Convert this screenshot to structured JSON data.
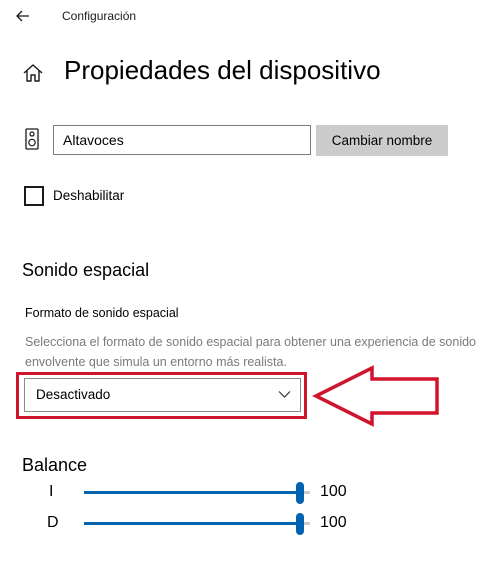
{
  "window": {
    "app_title": "Configuración"
  },
  "header": {
    "page_title": "Propiedades del dispositivo"
  },
  "device": {
    "name_value": "Altavoces",
    "rename_button_label": "Cambiar nombre"
  },
  "disable": {
    "label": "Deshabilitar",
    "checked": false
  },
  "spatial_sound": {
    "section_title": "Sonido espacial",
    "format_label": "Formato de sonido espacial",
    "format_description": "Selecciona el formato de sonido espacial para obtener una experiencia de sonido envolvente que simula un entorno más realista.",
    "selected_format": "Desactivado"
  },
  "balance": {
    "section_title": "Balance",
    "channels": [
      {
        "label": "I",
        "value": "100",
        "level": 1.0
      },
      {
        "label": "D",
        "value": "100",
        "level": 1.0
      }
    ]
  },
  "icons": {
    "back": "back-arrow-icon",
    "home": "home-icon",
    "speaker": "speaker-icon",
    "chevron": "chevron-down-icon"
  },
  "colors": {
    "accent": "#0063b1",
    "annotation_red": "#d0142c",
    "button_gray": "#cccccc",
    "muted_text": "#7a7a7a"
  }
}
